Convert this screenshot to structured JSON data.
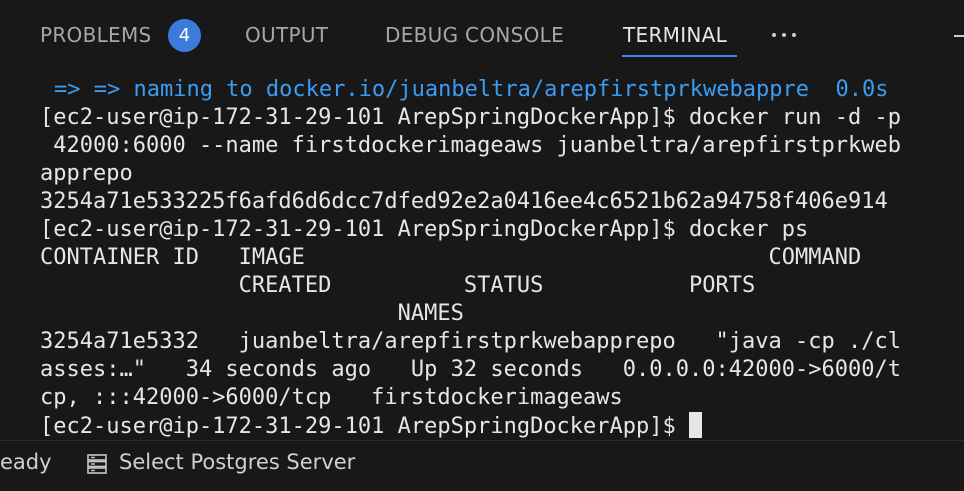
{
  "tabs": {
    "problems_label": "PROBLEMS",
    "problems_count": "4",
    "output_label": "OUTPUT",
    "debug_console_label": "DEBUG CONSOLE",
    "terminal_label": "TERMINAL",
    "active_tab": "TERMINAL"
  },
  "terminal": {
    "lines": [
      "=> => naming to docker.io/juanbeltra/arepfirstprkwebappre  0.0s",
      "[ec2-user@ip-172-31-29-101 ArepSpringDockerApp]$ docker run -d -p",
      " 42000:6000 --name firstdockerimageaws juanbeltra/arepfirstprkweb",
      "apprepo",
      "3254a71e533225f6afd6d6dcc7dfed92e2a0416ee4c6521b62a94758f406e914",
      "[ec2-user@ip-172-31-29-101 ArepSpringDockerApp]$ docker ps",
      "CONTAINER ID   IMAGE                                   COMMAND",
      "               CREATED          STATUS           PORTS",
      "                           NAMES",
      "3254a71e5332   juanbeltra/arepfirstprkwebapprepo   \"java -cp ./cl",
      "asses:…\"   34 seconds ago   Up 32 seconds   0.0.0.0:42000->6000/t",
      "cp, :::42000->6000/tcp   firstdockerimageaws",
      "[ec2-user@ip-172-31-29-101 ArepSpringDockerApp]$ "
    ]
  },
  "statusbar": {
    "ready_label": "eady",
    "server_label": "Select Postgres Server"
  },
  "colors": {
    "background": "#181818",
    "badge": "#3c7bdb",
    "active_underline": "#3b82f6",
    "terminal_blue": "#3b9df1",
    "terminal_text": "#e6e6e6"
  }
}
